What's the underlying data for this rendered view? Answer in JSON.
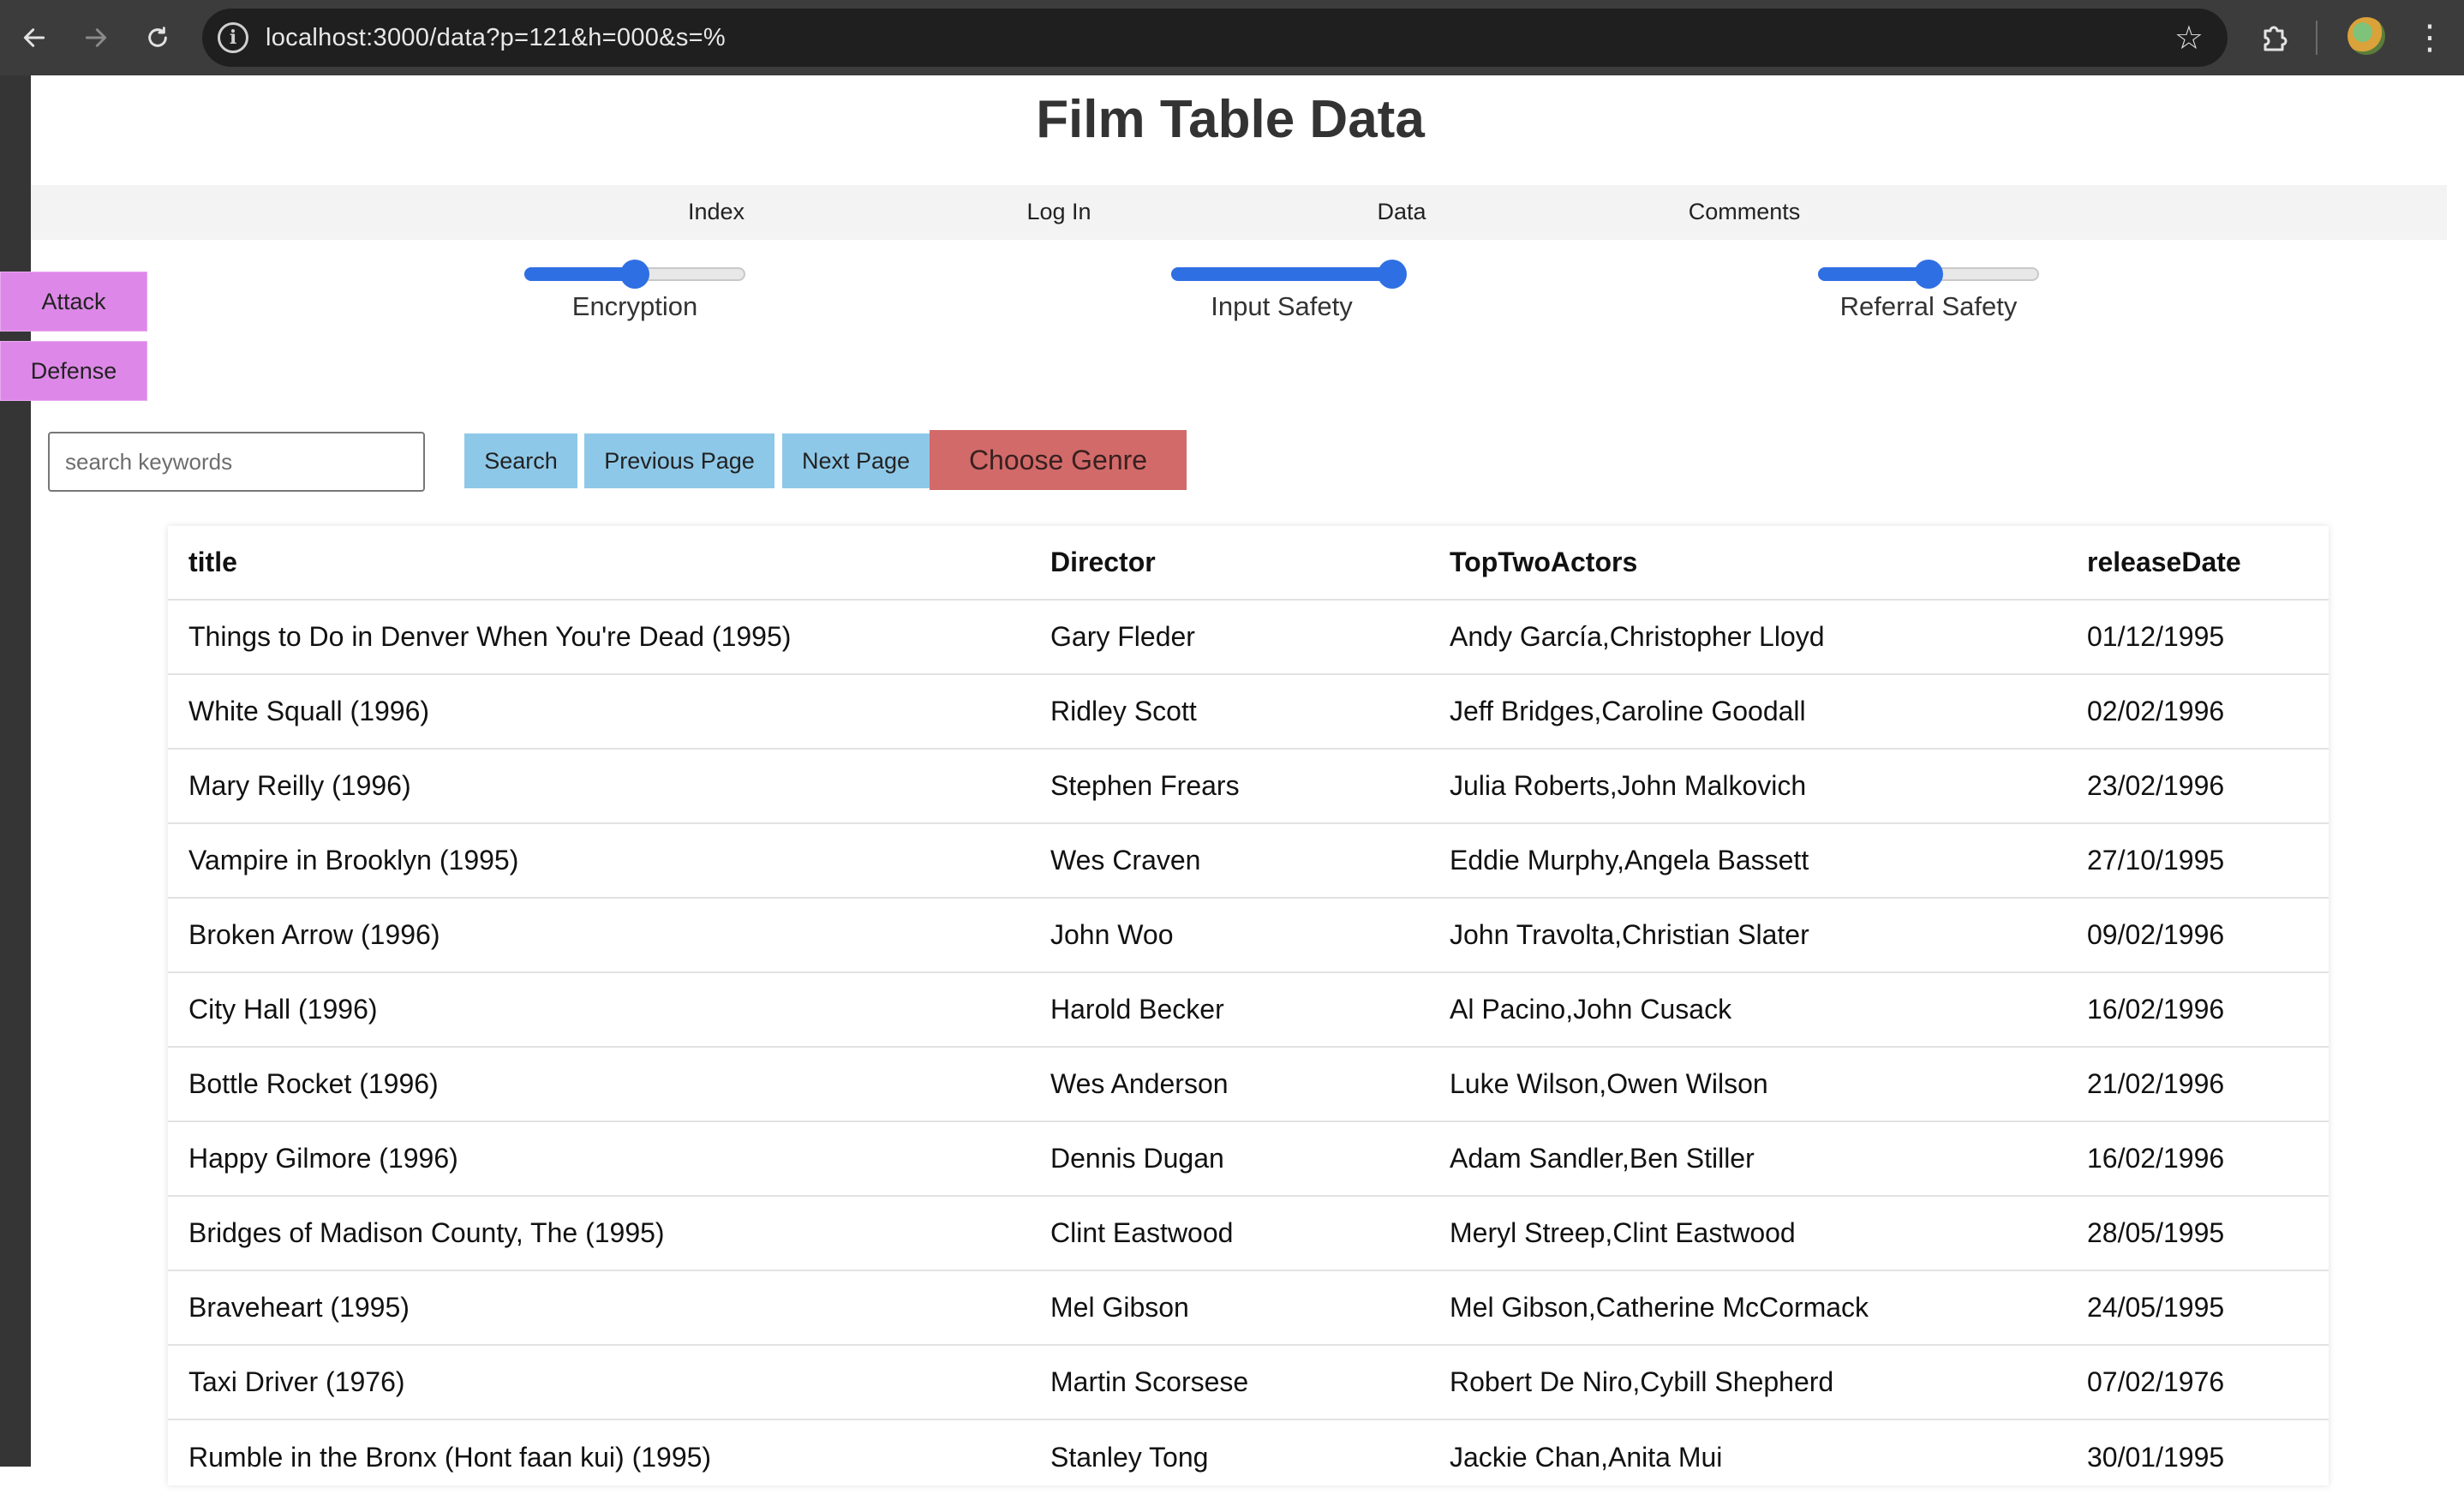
{
  "browser": {
    "url": "localhost:3000/data?p=121&h=000&s=%"
  },
  "page": {
    "title": "Film Table Data",
    "side_buttons": [
      {
        "label": "Attack"
      },
      {
        "label": "Defense"
      }
    ],
    "nav": [
      "Index",
      "Log In",
      "Data",
      "Comments"
    ],
    "sliders": [
      {
        "label": "Encryption",
        "level_fraction": 0.5
      },
      {
        "label": "Input Safety",
        "level_fraction": 1.0
      },
      {
        "label": "Referral Safety",
        "level_fraction": 0.5
      }
    ],
    "search": {
      "placeholder": "search keywords",
      "value": "",
      "search_label": "Search",
      "prev_label": "Previous Page",
      "next_label": "Next Page",
      "genre_label": "Choose Genre"
    },
    "colors": {
      "slider_accent": "#2f6fe4",
      "side_button": "#dd88e8",
      "control_button": "#8ec8e8",
      "genre_button": "#d26a6a"
    }
  },
  "table": {
    "headers": [
      "title",
      "Director",
      "TopTwoActors",
      "releaseDate"
    ],
    "rows": [
      [
        "Things to Do in Denver When You're Dead (1995)",
        "Gary Fleder",
        "Andy García,Christopher Lloyd",
        "01/12/1995"
      ],
      [
        "White Squall (1996)",
        "Ridley Scott",
        "Jeff Bridges,Caroline Goodall",
        "02/02/1996"
      ],
      [
        "Mary Reilly (1996)",
        "Stephen Frears",
        "Julia Roberts,John Malkovich",
        "23/02/1996"
      ],
      [
        "Vampire in Brooklyn (1995)",
        "Wes Craven",
        "Eddie Murphy,Angela Bassett",
        "27/10/1995"
      ],
      [
        "Broken Arrow (1996)",
        "John Woo",
        "John Travolta,Christian Slater",
        "09/02/1996"
      ],
      [
        "City Hall (1996)",
        "Harold Becker",
        "Al Pacino,John Cusack",
        "16/02/1996"
      ],
      [
        "Bottle Rocket (1996)",
        "Wes Anderson",
        "Luke Wilson,Owen Wilson",
        "21/02/1996"
      ],
      [
        "Happy Gilmore (1996)",
        "Dennis Dugan",
        "Adam Sandler,Ben Stiller",
        "16/02/1996"
      ],
      [
        "Bridges of Madison County, The (1995)",
        "Clint Eastwood",
        "Meryl Streep,Clint Eastwood",
        "28/05/1995"
      ],
      [
        "Braveheart (1995)",
        "Mel Gibson",
        "Mel Gibson,Catherine McCormack",
        "24/05/1995"
      ],
      [
        "Taxi Driver (1976)",
        "Martin Scorsese",
        "Robert De Niro,Cybill Shepherd",
        "07/02/1976"
      ],
      [
        "Rumble in the Bronx (Hont faan kui) (1995)",
        "Stanley Tong",
        "Jackie Chan,Anita Mui",
        "30/01/1995"
      ]
    ]
  }
}
